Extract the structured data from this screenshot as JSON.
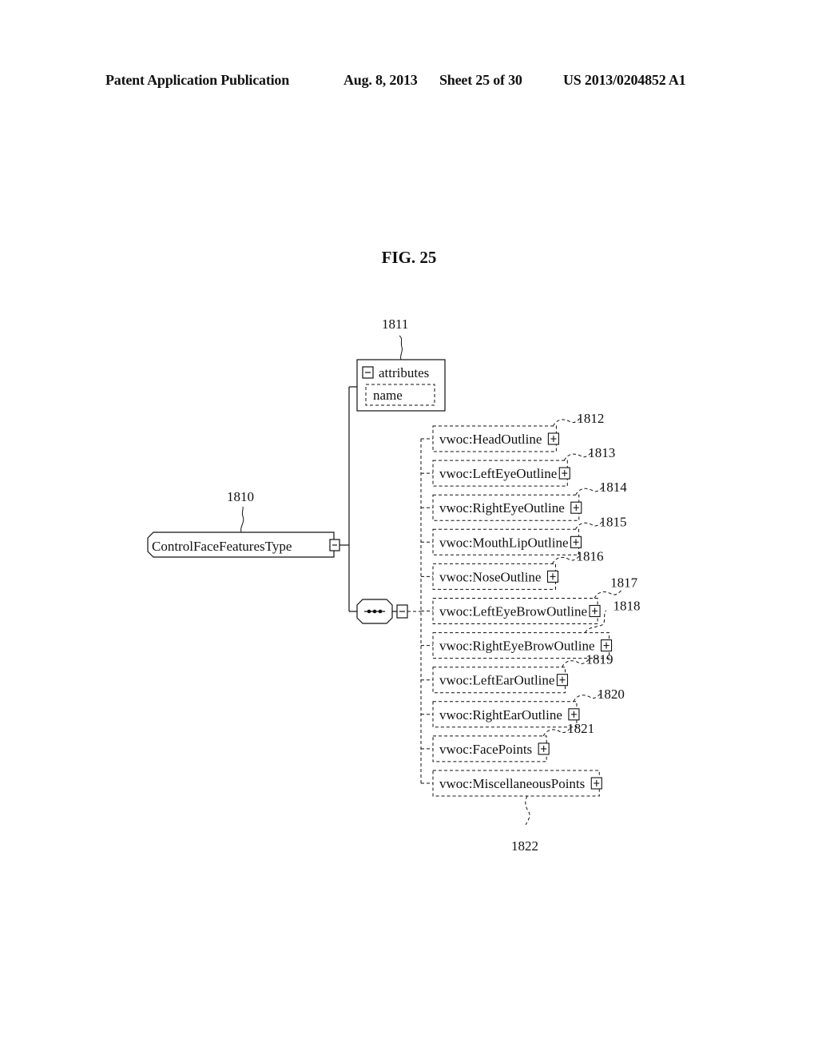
{
  "header": {
    "publication": "Patent Application Publication",
    "date": "Aug. 8, 2013",
    "sheet": "Sheet 25 of 30",
    "patent_number": "US 2013/0204852 A1"
  },
  "figure": {
    "title": "FIG. 25",
    "root": {
      "label": "ControlFaceFeaturesType",
      "ref": "1810",
      "toggle": "collapse"
    },
    "attributes": {
      "title": "attributes",
      "ref": "1811",
      "items": [
        "name"
      ],
      "toggle": "collapse"
    },
    "sequence": {
      "symbol": "sequence",
      "toggle": "collapse"
    },
    "elements": [
      {
        "label": "vwoc:HeadOutline",
        "ref": "1812"
      },
      {
        "label": "vwoc:LeftEyeOutline",
        "ref": "1813"
      },
      {
        "label": "vwoc:RightEyeOutline",
        "ref": "1814"
      },
      {
        "label": "vwoc:MouthLipOutline",
        "ref": "1815"
      },
      {
        "label": "vwoc:NoseOutline",
        "ref": "1816"
      },
      {
        "label": "vwoc:LeftEyeBrowOutline",
        "ref": "1817"
      },
      {
        "label": "vwoc:RightEyeBrowOutline",
        "ref": "1818"
      },
      {
        "label": "vwoc:LeftEarOutline",
        "ref": "1819"
      },
      {
        "label": "vwoc:RightEarOutline",
        "ref": "1820"
      },
      {
        "label": "vwoc:FacePoints",
        "ref": "1821"
      },
      {
        "label": "vwoc:MiscellaneousPoints",
        "ref": "1822"
      }
    ]
  }
}
